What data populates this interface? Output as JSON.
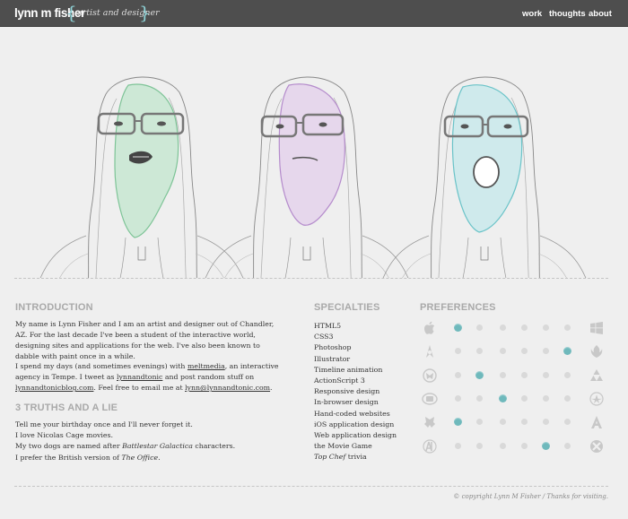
{
  "header": {
    "brand": "lynn m fisher",
    "brace_open": "{",
    "tagline": "artist and designer",
    "brace_close": "}",
    "nav": {
      "work": "work",
      "thoughts": "thoughts",
      "about": "about"
    }
  },
  "intro": {
    "heading": "INTRODUCTION",
    "p1": "My name is Lynn Fisher and I am an artist and designer out of Chandler, AZ. For the last decade I've been a student of the interactive world, designing sites and applications for the web. I've also been known to dabble with paint once in a while.",
    "p2_a": "I spend my days (and sometimes evenings) with ",
    "p2_link1": "meltmedia",
    "p2_b": ", an interactive agency in Tempe. I tweet as ",
    "p2_link2": "lynnandtonic",
    "p2_c": " and post random stuff on ",
    "p2_link3": "lynnandtonicblog.com",
    "p2_d": ". Feel free to email me at ",
    "p2_link4": "lynn@lynnandtonic.com",
    "p2_e": "."
  },
  "truths": {
    "heading": "3 TRUTHS AND A LIE",
    "l1": "Tell me your birthday once and I'll never forget it.",
    "l2": "I love Nicolas Cage movies.",
    "l3_a": "My two dogs are named after ",
    "l3_em": "Battlestar Galactica",
    "l3_b": " characters.",
    "l4_a": "I prefer the British version of ",
    "l4_em": "The Office",
    "l4_b": "."
  },
  "specialties": {
    "heading": "SPECIALTIES",
    "items": [
      "HTML5",
      "CSS3",
      "Photoshop",
      "Illustrator",
      "Timeline animation",
      "ActionScript 3",
      "Responsive design",
      "In-browser design",
      "Hand-coded websites",
      "iOS application design",
      "Web application design",
      "the Movie Game"
    ],
    "last_em": "Top Chef",
    "last_rest": " trivia"
  },
  "preferences": {
    "heading": "PREFERENCES",
    "rows": [
      {
        "left": "apple-icon",
        "right": "windows-icon",
        "level": 1
      },
      {
        "left": "starfleet-icon",
        "right": "rebel-alliance-icon",
        "level": 6
      },
      {
        "left": "autobot-icon",
        "right": "triforce-icon",
        "level": 2
      },
      {
        "left": "tardis-icon",
        "right": "starfleet-icon",
        "level": 3
      },
      {
        "left": "decepticon-icon",
        "right": "avengers-icon",
        "level": 1
      },
      {
        "left": "avengers-icon",
        "right": "x-men-icon",
        "level": 5
      }
    ]
  },
  "footer": "© copyright Lynn M Fisher / Thanks for visiting."
}
